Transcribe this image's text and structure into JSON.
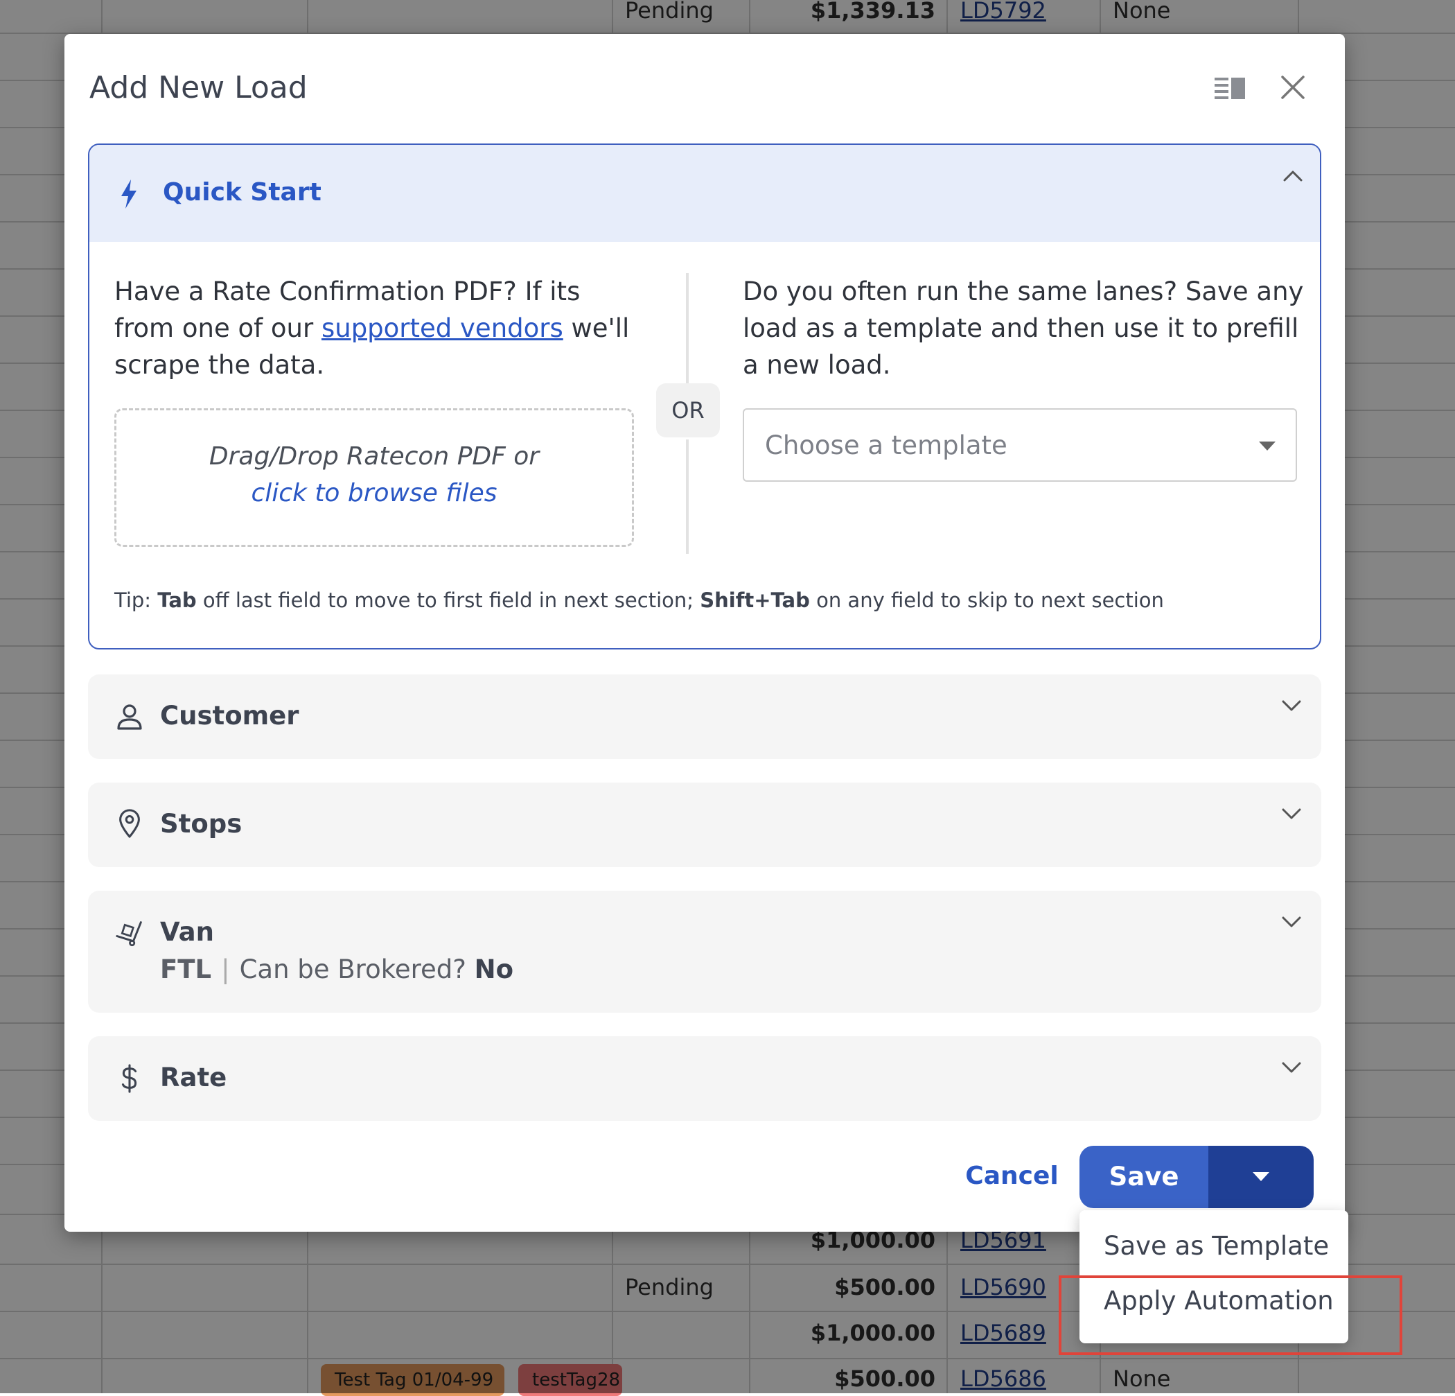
{
  "background_table": {
    "rows": [
      {
        "status": "Pending",
        "amount": "$1,339.13",
        "load_id": "LD5792",
        "extra": "None"
      },
      {
        "status": "",
        "amount": "$1,000.00",
        "load_id": "LD5691",
        "extra": ""
      },
      {
        "status": "Pending",
        "amount": "$500.00",
        "load_id": "LD5690",
        "extra": ""
      },
      {
        "status": "",
        "amount": "$1,000.00",
        "load_id": "LD5689",
        "extra": ""
      },
      {
        "status": "",
        "amount": "$500.00",
        "load_id": "LD5686",
        "extra": "None"
      }
    ],
    "tags": [
      "Test Tag 01/04-99",
      "testTag28"
    ]
  },
  "modal": {
    "title": "Add New Load",
    "quick_start": {
      "title": "Quick Start",
      "left_text_before": "Have a Rate Confirmation PDF? If its from one of our ",
      "left_link": "supported vendors",
      "left_text_after": " we'll scrape the data.",
      "drop_line1": "Drag/Drop Ratecon PDF or",
      "drop_line2": "click to browse files",
      "or_label": "OR",
      "right_text": "Do you often run the same lanes? Save any load as a template and then use it to prefill a new load.",
      "template_placeholder": "Choose a template",
      "tip_prefix": "Tip: ",
      "tip_key1": "Tab",
      "tip_mid": " off last field to move to first field in next section; ",
      "tip_key2": "Shift+Tab",
      "tip_suffix": " on any field to skip to next section"
    },
    "sections": {
      "customer": "Customer",
      "stops": "Stops",
      "van": "Van",
      "van_type": "FTL",
      "van_sep": "|",
      "van_brokered_label": "Can be Brokered? ",
      "van_brokered_value": "No",
      "rate": "Rate"
    },
    "footer": {
      "cancel": "Cancel",
      "save": "Save"
    },
    "save_menu": {
      "items": [
        "Save as Template",
        "Apply Automation"
      ]
    }
  },
  "colors": {
    "accent": "#2a57c4",
    "save_button": "#3a63c7",
    "save_dropdown": "#1f3f95",
    "highlight": "#e0443a"
  }
}
